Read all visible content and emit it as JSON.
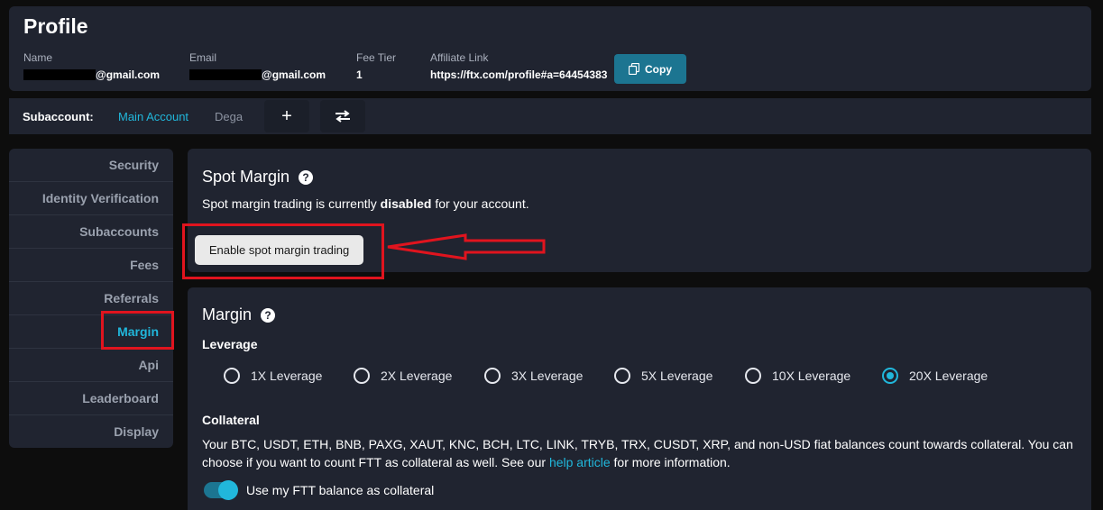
{
  "profile": {
    "title": "Profile",
    "name_label": "Name",
    "name_value": "@gmail.com",
    "email_label": "Email",
    "email_value": "@gmail.com",
    "fee_tier_label": "Fee Tier",
    "fee_tier_value": "1",
    "affiliate_label": "Affiliate Link",
    "affiliate_value": "https://ftx.com/profile#a=64454383",
    "copy_label": "Copy"
  },
  "subaccount": {
    "label": "Subaccount:",
    "main": "Main Account",
    "dega": "Dega",
    "add_icon": "plus-icon",
    "switch_icon": "swap-arrows-icon"
  },
  "sidebar": {
    "items": [
      {
        "label": "Security"
      },
      {
        "label": "Identity Verification"
      },
      {
        "label": "Subaccounts"
      },
      {
        "label": "Fees"
      },
      {
        "label": "Referrals"
      },
      {
        "label": "Margin"
      },
      {
        "label": "Api"
      },
      {
        "label": "Leaderboard"
      },
      {
        "label": "Display"
      }
    ],
    "active": "Margin"
  },
  "spot_margin": {
    "title": "Spot Margin",
    "desc_pre": "Spot margin trading is currently ",
    "desc_bold": "disabled",
    "desc_post": " for your account.",
    "enable_button": "Enable spot margin trading"
  },
  "margin": {
    "title": "Margin",
    "leverage_label": "Leverage",
    "leverage_options": [
      {
        "label": "1X Leverage",
        "checked": false
      },
      {
        "label": "2X Leverage",
        "checked": false
      },
      {
        "label": "3X Leverage",
        "checked": false
      },
      {
        "label": "5X Leverage",
        "checked": false
      },
      {
        "label": "10X Leverage",
        "checked": false
      },
      {
        "label": "20X Leverage",
        "checked": true
      }
    ],
    "collateral_label": "Collateral",
    "collateral_text_1": "Your BTC, USDT, ETH, BNB, PAXG, XAUT, KNC, BCH, LTC, LINK, TRYB, TRX, CUSDT, XRP, and non-USD fiat balances count towards collateral. You can choose if you want to count FTT as collateral as well. See our ",
    "collateral_link": "help article",
    "collateral_text_2": " for more information.",
    "ftt_toggle_label": "Use my FTT balance as collateral",
    "ftt_toggle_on": true
  },
  "colors": {
    "accent": "#21b7db",
    "highlight": "#e0141e",
    "panel": "#202430",
    "background": "#0d0d0d"
  }
}
